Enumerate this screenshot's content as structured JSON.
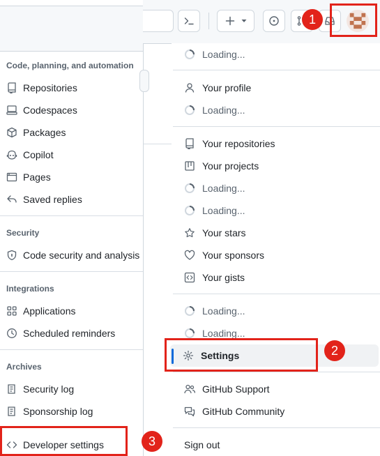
{
  "sidebar": {
    "sections": [
      {
        "heading": "Code, planning, and automation",
        "items": [
          {
            "label": "Repositories",
            "icon": "repo-icon"
          },
          {
            "label": "Codespaces",
            "icon": "codespaces-icon"
          },
          {
            "label": "Packages",
            "icon": "package-icon"
          },
          {
            "label": "Copilot",
            "icon": "copilot-icon"
          },
          {
            "label": "Pages",
            "icon": "browser-icon"
          },
          {
            "label": "Saved replies",
            "icon": "reply-icon"
          }
        ]
      },
      {
        "heading": "Security",
        "items": [
          {
            "label": "Code security and analysis",
            "icon": "shield-lock-icon"
          }
        ]
      },
      {
        "heading": "Integrations",
        "items": [
          {
            "label": "Applications",
            "icon": "apps-icon"
          },
          {
            "label": "Scheduled reminders",
            "icon": "clock-icon"
          }
        ]
      },
      {
        "heading": "Archives",
        "items": [
          {
            "label": "Security log",
            "icon": "log-icon"
          },
          {
            "label": "Sponsorship log",
            "icon": "log-icon"
          },
          {
            "label": "Developer settings",
            "icon": "code-icon"
          }
        ]
      }
    ]
  },
  "menu": {
    "loading": "Loading...",
    "profile": "Your profile",
    "repositories": "Your repositories",
    "projects": "Your projects",
    "stars": "Your stars",
    "sponsors": "Your sponsors",
    "gists": "Your gists",
    "settings": "Settings",
    "support": "GitHub Support",
    "community": "GitHub Community",
    "sign_out": "Sign out"
  },
  "annotations": {
    "one": "1",
    "two": "2",
    "three": "3",
    "color": "#e2231a"
  },
  "colors": {
    "accent": "#0969da",
    "text": "#1f2328",
    "muted": "#59636e"
  }
}
